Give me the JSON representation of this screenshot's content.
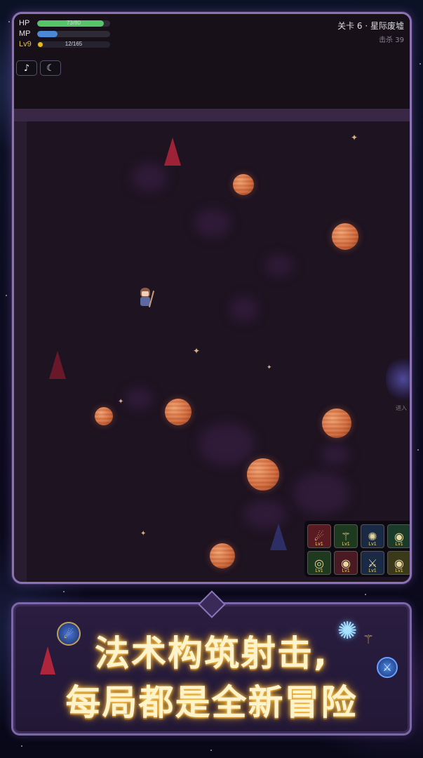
{
  "hud": {
    "hp_label": "HP",
    "hp_text": "73/80",
    "hp_fraction": 0.91,
    "mp_label": "MP",
    "mp_fraction": 0.28,
    "lv_label": "Lv9",
    "xp_text": "12/165",
    "xp_fraction": 0.07,
    "music_icon": "♪",
    "theme_icon": "☾"
  },
  "level": {
    "title": "关卡 6 · 星际废墟",
    "kills": "击杀 39"
  },
  "portal_label": "进入",
  "skills": [
    {
      "icon": "comet-icon",
      "glyph": "☄",
      "level": "Lv1",
      "color": "#5a1a22"
    },
    {
      "icon": "bone-icon",
      "glyph": "⚚",
      "level": "Lv1",
      "color": "#1e3a1e"
    },
    {
      "icon": "frost-icon",
      "glyph": "✺",
      "level": "Lv1",
      "color": "#1a2a44"
    },
    {
      "icon": "globe-icon",
      "glyph": "◉",
      "level": "Lv1",
      "color": "#1a3a2a"
    },
    {
      "icon": "ring-icon",
      "glyph": "◎",
      "level": "Lv1",
      "color": "#1e3a1e"
    },
    {
      "icon": "earth-icon",
      "glyph": "◉",
      "level": "Lv1",
      "color": "#4a1a22"
    },
    {
      "icon": "sword-icon",
      "glyph": "⚔",
      "level": "Lv1",
      "color": "#1a2a44"
    },
    {
      "icon": "flame-orb-icon",
      "glyph": "◉",
      "level": "Lv1",
      "color": "#3a3a1a"
    }
  ],
  "banner": {
    "line1": "法术构筑射击,",
    "line2": "每局都是全新冒险"
  },
  "colors": {
    "frame_border": "#8a72b4",
    "hp": "#56c46a",
    "mp": "#4b88d6",
    "xp": "#e2b52a",
    "banner_text": "#fff3cc"
  }
}
